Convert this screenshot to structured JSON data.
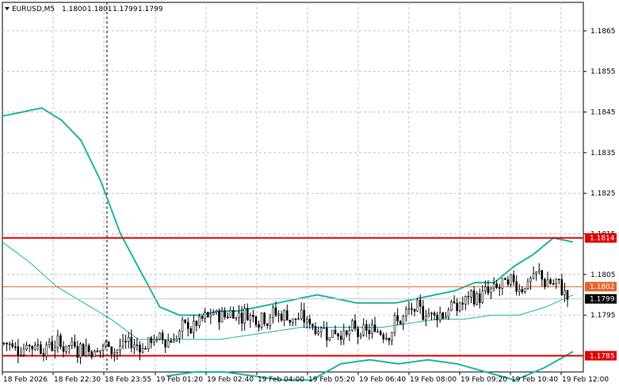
{
  "header": {
    "dropdown_icon": "triangle-down-icon",
    "symbol": "EURUSD,M5",
    "open": "1.1800",
    "high": "1.1801",
    "low": "1.1799",
    "close": "1.1799"
  },
  "price_axis": {
    "ticks": [
      "1.1865",
      "1.1855",
      "1.1845",
      "1.1835",
      "1.1825",
      "1.1815",
      "1.1805",
      "1.1795"
    ]
  },
  "time_axis": {
    "ticks": [
      "18 Feb 2026",
      "18 Feb 22:30",
      "18 Feb 23:55",
      "19 Feb 01:20",
      "19 Feb 02:40",
      "19 Feb 04:00",
      "19 Feb 05:20",
      "19 Feb 06:40",
      "19 Feb 08:00",
      "19 Feb 09:20",
      "19 Feb 10:40",
      "19 Feb 12:00"
    ]
  },
  "levels": [
    {
      "name": "resistance",
      "label": "1.1814",
      "price": 1.1814,
      "color": "#e00000"
    },
    {
      "name": "mid-level",
      "label": "1.1802",
      "price": 1.1802,
      "color": "#e8642c"
    },
    {
      "name": "support",
      "label": "1.1785",
      "price": 1.1785,
      "color": "#e00000"
    }
  ],
  "current_price": {
    "label": "1.1799",
    "price": 1.1799
  },
  "colors": {
    "band": "#1fb5a6",
    "ma": "#26b3a6",
    "candle": "#000000",
    "grid": "#c0c0c0"
  },
  "chart_data": {
    "type": "candlestick",
    "y_range": [
      1.1781,
      1.1872
    ],
    "upper_band": [
      1.1844,
      1.1845,
      1.1846,
      1.1843,
      1.1838,
      1.1828,
      1.1815,
      1.1806,
      1.1797,
      1.1795,
      1.1795,
      1.1796,
      1.1796,
      1.1797,
      1.1798,
      1.1799,
      1.18,
      1.1799,
      1.1798,
      1.1798,
      1.1798,
      1.1799,
      1.18,
      1.1801,
      1.1803,
      1.1803,
      1.1807,
      1.181,
      1.1814,
      1.1813
    ],
    "middle_band": [
      1.1813,
      1.1808,
      1.1802,
      1.1798,
      1.1794,
      1.1789,
      1.1789,
      1.1789,
      1.1789,
      1.179,
      1.1791,
      1.1792,
      1.1792,
      1.1792,
      1.1792,
      1.1793,
      1.1794,
      1.1794,
      1.1795,
      1.1795,
      1.1797,
      1.18
    ],
    "lower_band": [
      1.178,
      1.1781,
      1.1781,
      1.178,
      1.1779,
      1.1779,
      1.1783,
      1.1784,
      1.1783,
      1.1784,
      1.1783,
      1.1781,
      1.1779,
      1.1782,
      1.1786
    ],
    "candles_note": "approximately 200 M5 candles; closes trend from ~1.1788 up to ~1.1800, ranging 1.1786-1.1807"
  }
}
